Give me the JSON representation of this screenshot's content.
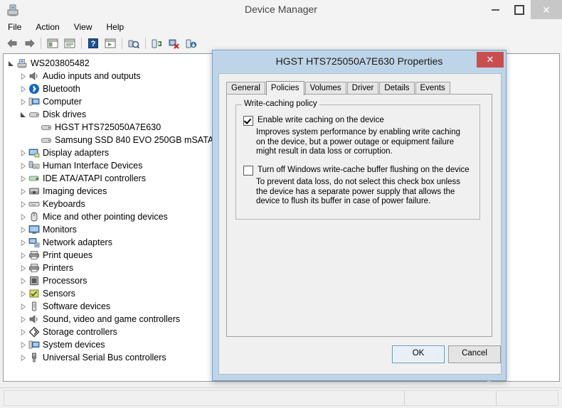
{
  "window": {
    "title": "Device Manager",
    "icon": "device-manager-icon",
    "controls": {
      "minimize": "–",
      "maximize": "□",
      "close": "✕"
    }
  },
  "menubar": {
    "items": [
      "File",
      "Action",
      "View",
      "Help"
    ]
  },
  "toolbar": {
    "items": [
      {
        "name": "back-icon",
        "title": "Back"
      },
      {
        "name": "forward-icon",
        "title": "Forward"
      },
      {
        "name": "separator",
        "title": ""
      },
      {
        "name": "show-hide-console-tree-icon",
        "title": "Show/Hide Console Tree"
      },
      {
        "name": "properties-icon",
        "title": "Properties"
      },
      {
        "name": "separator",
        "title": ""
      },
      {
        "name": "help-icon",
        "title": "Help"
      },
      {
        "name": "view-icon",
        "title": "View"
      },
      {
        "name": "separator",
        "title": ""
      },
      {
        "name": "scan-for-hardware-changes-icon",
        "title": "Scan for hardware changes"
      },
      {
        "name": "separator",
        "title": ""
      },
      {
        "name": "update-driver-icon",
        "title": "Update Driver Software"
      },
      {
        "name": "uninstall-device-icon",
        "title": "Uninstall"
      },
      {
        "name": "enable-device-icon",
        "title": "Enable device"
      }
    ]
  },
  "tree": {
    "nodes": [
      {
        "label": "WS203805482",
        "depth": 0,
        "state": "expanded",
        "icon": "computer-root-icon"
      },
      {
        "label": "Audio inputs and outputs",
        "depth": 1,
        "state": "collapsed",
        "icon": "speaker-icon"
      },
      {
        "label": "Bluetooth",
        "depth": 1,
        "state": "collapsed",
        "icon": "bluetooth-icon"
      },
      {
        "label": "Computer",
        "depth": 1,
        "state": "collapsed",
        "icon": "computer-icon"
      },
      {
        "label": "Disk drives",
        "depth": 1,
        "state": "expanded",
        "icon": "disk-drive-icon"
      },
      {
        "label": "HGST HTS725050A7E630",
        "depth": 2,
        "state": "leaf",
        "icon": "disk-drive-icon"
      },
      {
        "label": "Samsung SSD 840 EVO 250GB mSATA",
        "depth": 2,
        "state": "leaf",
        "icon": "disk-drive-icon"
      },
      {
        "label": "Display adapters",
        "depth": 1,
        "state": "collapsed",
        "icon": "display-adapter-icon"
      },
      {
        "label": "Human Interface Devices",
        "depth": 1,
        "state": "collapsed",
        "icon": "hid-icon"
      },
      {
        "label": "IDE ATA/ATAPI controllers",
        "depth": 1,
        "state": "collapsed",
        "icon": "ide-controller-icon"
      },
      {
        "label": "Imaging devices",
        "depth": 1,
        "state": "collapsed",
        "icon": "camera-icon"
      },
      {
        "label": "Keyboards",
        "depth": 1,
        "state": "collapsed",
        "icon": "keyboard-icon"
      },
      {
        "label": "Mice and other pointing devices",
        "depth": 1,
        "state": "collapsed",
        "icon": "mouse-icon"
      },
      {
        "label": "Monitors",
        "depth": 1,
        "state": "collapsed",
        "icon": "monitor-icon"
      },
      {
        "label": "Network adapters",
        "depth": 1,
        "state": "collapsed",
        "icon": "network-adapter-icon"
      },
      {
        "label": "Print queues",
        "depth": 1,
        "state": "collapsed",
        "icon": "printer-icon"
      },
      {
        "label": "Printers",
        "depth": 1,
        "state": "collapsed",
        "icon": "printer-icon"
      },
      {
        "label": "Processors",
        "depth": 1,
        "state": "collapsed",
        "icon": "processor-icon"
      },
      {
        "label": "Sensors",
        "depth": 1,
        "state": "collapsed",
        "icon": "sensor-icon"
      },
      {
        "label": "Software devices",
        "depth": 1,
        "state": "collapsed",
        "icon": "software-device-icon"
      },
      {
        "label": "Sound, video and game controllers",
        "depth": 1,
        "state": "collapsed",
        "icon": "speaker-icon"
      },
      {
        "label": "Storage controllers",
        "depth": 1,
        "state": "collapsed",
        "icon": "storage-controller-icon"
      },
      {
        "label": "System devices",
        "depth": 1,
        "state": "collapsed",
        "icon": "computer-icon"
      },
      {
        "label": "Universal Serial Bus controllers",
        "depth": 1,
        "state": "collapsed",
        "icon": "usb-icon"
      }
    ]
  },
  "dialog": {
    "title": "HGST HTS725050A7E630 Properties",
    "close_label": "✕",
    "tabs": [
      {
        "label": "General",
        "active": false
      },
      {
        "label": "Policies",
        "active": true
      },
      {
        "label": "Volumes",
        "active": false
      },
      {
        "label": "Driver",
        "active": false
      },
      {
        "label": "Details",
        "active": false
      },
      {
        "label": "Events",
        "active": false
      }
    ],
    "group_title": "Write-caching policy",
    "option1": {
      "label": "Enable write caching on the device",
      "checked": true,
      "help": "Improves system performance by enabling write caching on the device, but a power outage or equipment failure might result in data loss or corruption."
    },
    "option2": {
      "label": "Turn off Windows write-cache buffer flushing on the device",
      "checked": false,
      "help": "To prevent data loss, do not select this check box unless the device has a separate power supply that allows the device to flush its buffer in case of power failure."
    },
    "buttons": {
      "ok": "OK",
      "cancel": "Cancel"
    }
  },
  "statusbar": {
    "text": ""
  },
  "colors": {
    "dialog_frame": "#bed4e8",
    "close_button": "#c94f4f",
    "window_bg": "#f0f0f0",
    "pane_bg": "#ffffff",
    "default_button_border": "#5a91c4"
  }
}
